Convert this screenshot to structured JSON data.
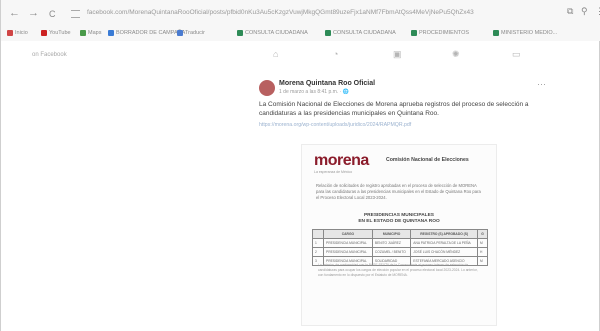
{
  "browser": {
    "back": "←",
    "forward": "→",
    "reload": "C",
    "url": "facebook.com/MorenaQuintanaRooOficial/posts/pfbid0nKu3Au5cKzgzVuwjMkgQGmt89uzeFjx1aNMf7FbmAtQss4MeVjNePu5QhZx43"
  },
  "bookmarks": [
    {
      "label": "Inicio",
      "color": "#d04545"
    },
    {
      "label": "YouTube",
      "color": "#cc2222"
    },
    {
      "label": "Maps",
      "color": "#4a9a4a"
    },
    {
      "label": "BORRADOR DE CAMPAÑA",
      "color": "#3a7bd5"
    },
    {
      "label": "Traducir",
      "color": "#4a7bd0"
    },
    {
      "label": "CONSULTA CIUDADANA",
      "color": "#2e8b57"
    },
    {
      "label": "CONSULTA CIUDADANA",
      "color": "#2e8b57"
    },
    {
      "label": "PROCEDIMIENTOS",
      "color": "#2e8b57"
    },
    {
      "label": "MINISTERIO MEDIO...",
      "color": "#2e8b57"
    }
  ],
  "facebook": {
    "label": "on Facebook"
  },
  "post": {
    "author": "Morena Quintana Roo Oficial",
    "date": "1 de marzo a las 8:41 p.m. · 🌐",
    "text": "La Comisión Nacional de Elecciones de Morena aprueba registros del proceso de selección a candidaturas a las presidencias municipales en Quintana Roo.",
    "link": "https://morena.org/wp-content/uploads/juridico/2024/RAPMQR.pdf"
  },
  "document": {
    "logo": "morena",
    "logo_sub": "La esperanza de México",
    "org": "Comisión Nacional de Elecciones",
    "body": "Relación de solicitudes de registro aprobadas en el proceso de selección de MORENA para las candidaturas a las presidencias municipales en el Estado de Quintana Roo para el Proceso Electoral Local 2023-2024.",
    "title_line1": "PRESIDENCIAS MUNICIPALES",
    "title_line2": "EN EL ESTADO DE QUINTANA ROO",
    "table": {
      "headers": [
        "",
        "CARGO",
        "MUNICIPIO",
        "REGISTRO (S) APROBADO (S)",
        "G"
      ],
      "rows": [
        [
          "1",
          "PRESIDENCIA MUNICIPAL",
          "BENITO JUÁREZ",
          "ANA PATRICIA PERALTA DE LA PEÑA",
          "M"
        ],
        [
          "2",
          "PRESIDENCIA MUNICIPAL",
          "COZUMEL / BENITO",
          "JOSÉ LUIS CHACÓN MÉNDEZ",
          "H"
        ],
        [
          "3",
          "PRESIDENCIA MUNICIPAL",
          "SOLIDARIDAD",
          "ESTEFANÍA MERCADO ASENCIO",
          "M"
        ]
      ]
    },
    "footer": "Lo anterior, de conformidad con la BASE SEXTA de la Convocatoria al proceso interno de selección de candidaturas para ocupar los cargos de elección popular en el proceso electoral local 2023-2024. Lo anterior, con fundamento en lo dispuesto por el Estatuto de MORENA."
  }
}
